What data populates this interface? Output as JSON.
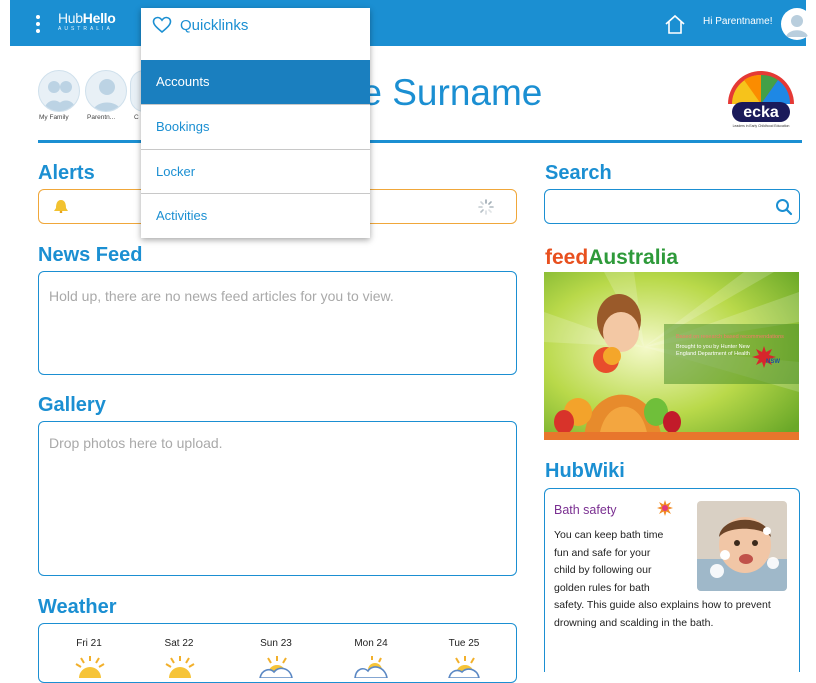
{
  "header": {
    "logo_part1": "Hub",
    "logo_part2": "Hello",
    "logo_sub": "AUSTRALIA",
    "greeting": "Hi Parentname!"
  },
  "family": [
    {
      "label": "My Family"
    },
    {
      "label": "Parentn..."
    },
    {
      "label": "C"
    }
  ],
  "profile": {
    "name_visible": "ame Surname"
  },
  "ecka": {
    "wordmark": "ecka",
    "tagline": "Leaders in Early Childhood Education"
  },
  "alerts": {
    "heading": "Alerts"
  },
  "news_feed": {
    "heading": "News Feed",
    "empty_text": "Hold up, there are no news feed articles for you to view."
  },
  "gallery": {
    "heading": "Gallery",
    "drop_text": "Drop photos here to upload."
  },
  "weather": {
    "heading": "Weather",
    "days": [
      {
        "label": "Fri 21",
        "condition": "sunny"
      },
      {
        "label": "Sat 22",
        "condition": "sunny"
      },
      {
        "label": "Sun 23",
        "condition": "partly-cloudy"
      },
      {
        "label": "Mon 24",
        "condition": "cloudy"
      },
      {
        "label": "Tue 25",
        "condition": "partly-cloudy"
      }
    ]
  },
  "search": {
    "heading": "Search",
    "value": "",
    "placeholder": ""
  },
  "feed_australia": {
    "logo_feed": "feed",
    "logo_australia": "Australia",
    "caption_line1": "Based on research based recommendations",
    "caption_line2": "Brought to you by Hunter New",
    "caption_line3": "England Department of Health",
    "nsw": "NSW"
  },
  "hubwiki": {
    "heading": "HubWiki",
    "article_title": "Bath safety",
    "text_line1": "You can keep bath time",
    "text_line2": "fun and safe for your",
    "text_line3": "child by following our",
    "text_line4": "golden rules for bath",
    "text_rest": "safety. This guide also explains how to prevent drowning and scalding in the bath."
  },
  "quicklinks": {
    "title": "Quicklinks",
    "items": [
      {
        "label": "Accounts",
        "active": true
      },
      {
        "label": "Bookings",
        "active": false
      },
      {
        "label": "Locker",
        "active": false
      },
      {
        "label": "Activities",
        "active": false
      }
    ]
  },
  "colors": {
    "brand_blue": "#1b8fd2",
    "alert_orange": "#f0a73a",
    "wiki_purple": "#7a2f91",
    "feed_orange": "#e8501f",
    "feed_green": "#2e9a3a"
  },
  "icons": [
    "menu-kebab-icon",
    "home-icon",
    "user-avatar-icon",
    "bell-icon",
    "spinner-icon",
    "search-icon",
    "heart-icon",
    "sun-icon",
    "cloud-icon",
    "burst-badge-icon"
  ]
}
